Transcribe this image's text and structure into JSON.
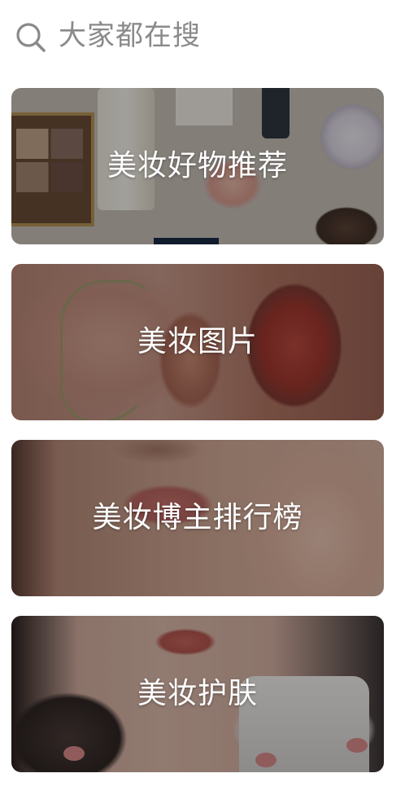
{
  "search": {
    "icon": "search-icon",
    "label": "大家都在搜"
  },
  "cards": [
    {
      "title": "美妆好物推荐",
      "image": "cosmetics-flatlay"
    },
    {
      "title": "美妆图片",
      "image": "face-lips-closeup"
    },
    {
      "title": "美妆博主排行榜",
      "image": "lips-hand-closeup"
    },
    {
      "title": "美妆护肤",
      "image": "face-cream-jar"
    }
  ],
  "colors": {
    "search_text": "#8a8a8a",
    "card_title": "#ffffff",
    "overlay": "rgba(0,0,0,0.34)"
  }
}
